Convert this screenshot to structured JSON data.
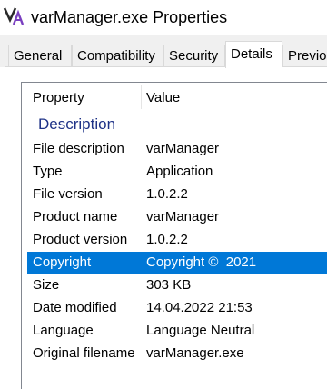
{
  "window": {
    "title": "varManager.exe Properties",
    "icon": "varmanager-app-icon"
  },
  "tabs": [
    {
      "label": "General",
      "active": false
    },
    {
      "label": "Compatibility",
      "active": false
    },
    {
      "label": "Security",
      "active": false
    },
    {
      "label": "Details",
      "active": true
    },
    {
      "label": "Previous Versions",
      "active": false
    }
  ],
  "details": {
    "columns": {
      "property": "Property",
      "value": "Value"
    },
    "group": "Description",
    "rows": [
      {
        "property": "File description",
        "value": "varManager",
        "selected": false
      },
      {
        "property": "Type",
        "value": "Application",
        "selected": false
      },
      {
        "property": "File version",
        "value": "1.0.2.2",
        "selected": false
      },
      {
        "property": "Product name",
        "value": "varManager",
        "selected": false
      },
      {
        "property": "Product version",
        "value": "1.0.2.2",
        "selected": false
      },
      {
        "property": "Copyright",
        "value": "Copyright ©  2021",
        "selected": true
      },
      {
        "property": "Size",
        "value": "303 KB",
        "selected": false
      },
      {
        "property": "Date modified",
        "value": "14.04.2022 21:53",
        "selected": false
      },
      {
        "property": "Language",
        "value": "Language Neutral",
        "selected": false
      },
      {
        "property": "Original filename",
        "value": "varManager.exe",
        "selected": false
      }
    ]
  },
  "colors": {
    "selection": "#0078d7",
    "group_header": "#1e3287"
  }
}
